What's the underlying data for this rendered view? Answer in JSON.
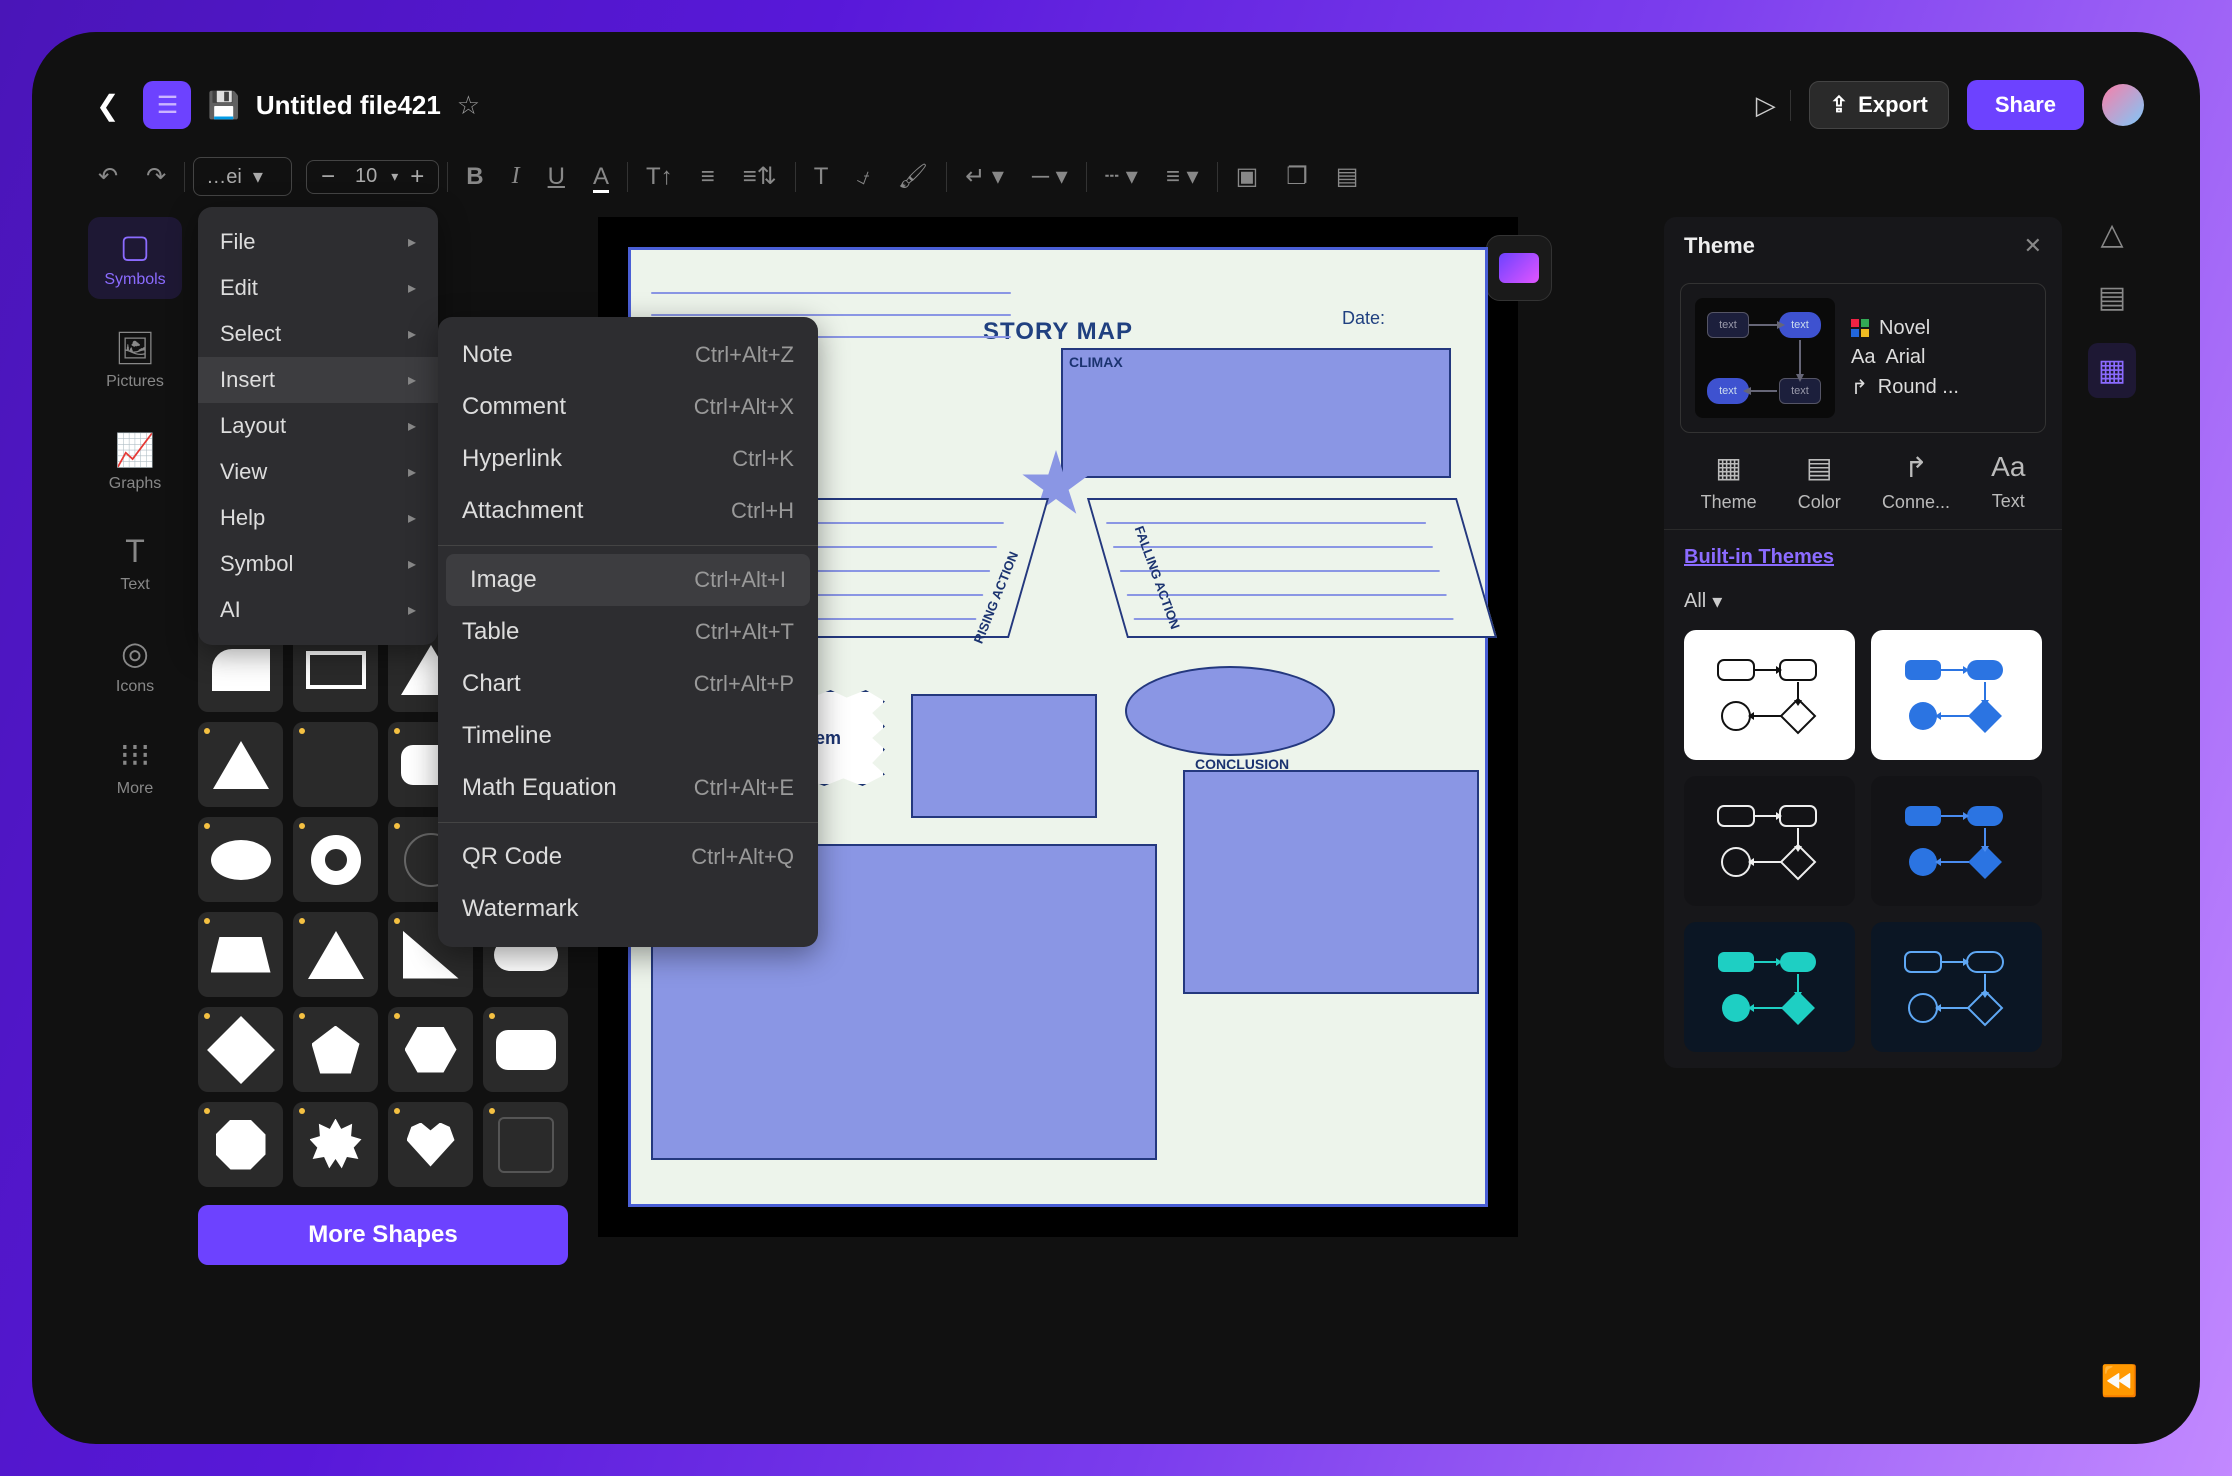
{
  "header": {
    "title": "Untitled file421",
    "export": "Export",
    "share": "Share"
  },
  "toolbar": {
    "font": "Arial",
    "font_size": "10"
  },
  "leftbar": [
    {
      "label": "Symbols"
    },
    {
      "label": "Pictures"
    },
    {
      "label": "Graphs"
    },
    {
      "label": "Text"
    },
    {
      "label": "Icons"
    },
    {
      "label": "More"
    }
  ],
  "shapes_panel": {
    "more": "More Shapes"
  },
  "main_menu": [
    "File",
    "Edit",
    "Select",
    "Insert",
    "Layout",
    "View",
    "Help",
    "Symbol",
    "AI"
  ],
  "insert_menu": [
    {
      "label": "Note",
      "shortcut": "Ctrl+Alt+Z"
    },
    {
      "label": "Comment",
      "shortcut": "Ctrl+Alt+X"
    },
    {
      "label": "Hyperlink",
      "shortcut": "Ctrl+K"
    },
    {
      "label": "Attachment",
      "shortcut": "Ctrl+H"
    },
    {
      "sep": true
    },
    {
      "label": "Image",
      "shortcut": "Ctrl+Alt+I",
      "sel": true
    },
    {
      "label": "Table",
      "shortcut": "Ctrl+Alt+T"
    },
    {
      "label": "Chart",
      "shortcut": "Ctrl+Alt+P"
    },
    {
      "label": "Timeline",
      "shortcut": ""
    },
    {
      "label": "Math Equation",
      "shortcut": "Ctrl+Alt+E"
    },
    {
      "sep": true
    },
    {
      "label": "QR Code",
      "shortcut": "Ctrl+Alt+Q"
    },
    {
      "label": "Watermark",
      "shortcut": ""
    }
  ],
  "canvas": {
    "title": "STORY MAP",
    "date": "Date:",
    "climax": "CLIMAX",
    "rising": "RISING ACTION",
    "falling": "FALLING ACTION",
    "problem": "Problem",
    "conclusion": "CONCLUSION"
  },
  "theme_panel": {
    "title": "Theme",
    "name": "Novel",
    "font": "Arial",
    "connector": "Round ...",
    "tabs": [
      "Theme",
      "Color",
      "Conne...",
      "Text"
    ],
    "builtin": "Built-in Themes",
    "filter": "All",
    "thumb_text": "text"
  }
}
